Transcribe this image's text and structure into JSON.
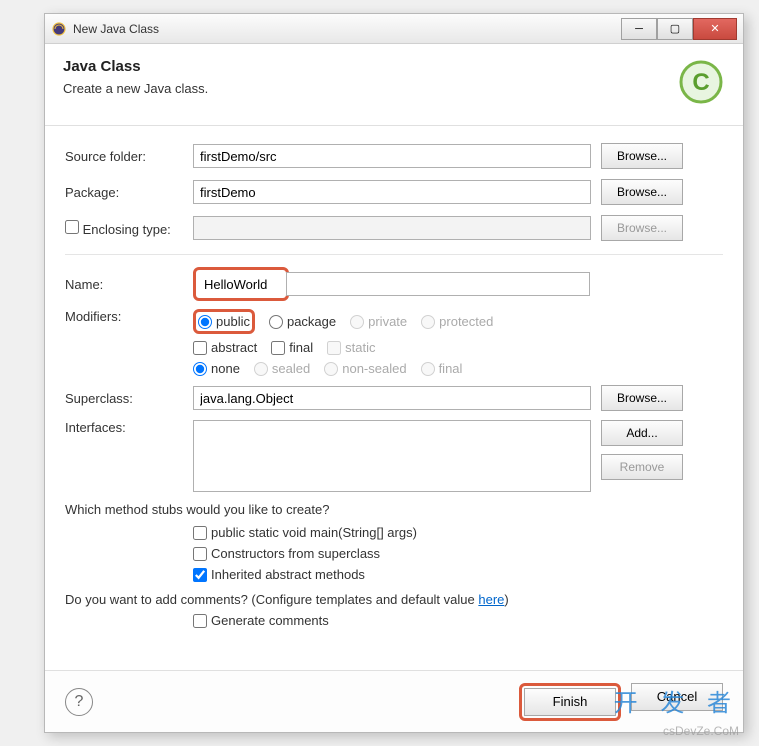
{
  "window": {
    "title": "New Java Class"
  },
  "header": {
    "title": "Java Class",
    "subtitle": "Create a new Java class."
  },
  "fields": {
    "source_folder": {
      "label": "Source folder:",
      "value": "firstDemo/src",
      "browse": "Browse..."
    },
    "package": {
      "label": "Package:",
      "value": "firstDemo",
      "browse": "Browse..."
    },
    "enclosing_type": {
      "label": "Enclosing type:",
      "value": "",
      "browse": "Browse..."
    },
    "name": {
      "label": "Name:",
      "value": "HelloWorld"
    },
    "modifiers": {
      "label": "Modifiers:",
      "access": [
        "public",
        "package",
        "private",
        "protected"
      ],
      "flags": [
        "abstract",
        "final",
        "static"
      ],
      "sealed": [
        "none",
        "sealed",
        "non-sealed",
        "final"
      ]
    },
    "superclass": {
      "label": "Superclass:",
      "value": "java.lang.Object",
      "browse": "Browse..."
    },
    "interfaces": {
      "label": "Interfaces:",
      "add": "Add...",
      "remove": "Remove"
    }
  },
  "stubs": {
    "question": "Which method stubs would you like to create?",
    "main": "public static void main(String[] args)",
    "constructors": "Constructors from superclass",
    "inherited": "Inherited abstract methods"
  },
  "comments": {
    "question_pre": "Do you want to add comments? (Configure templates and default value ",
    "link": "here",
    "question_post": ")",
    "generate": "Generate comments"
  },
  "footer": {
    "finish": "Finish",
    "cancel": "Cancel"
  },
  "watermark": {
    "text": "开 发 者",
    "sub": "csDevZe.CoM"
  }
}
